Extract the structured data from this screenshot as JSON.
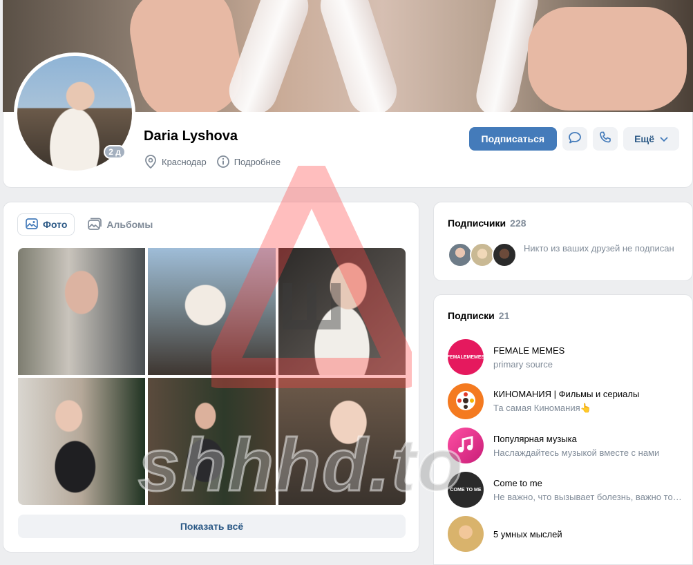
{
  "profile": {
    "name": "Daria Lyshova",
    "online_badge": "2 д",
    "city": "Краснодар",
    "details_label": "Подробнее"
  },
  "actions": {
    "subscribe_label": "Подписаться",
    "more_label": "Ещё"
  },
  "photos": {
    "tabs": [
      {
        "label": "Фото",
        "icon": "photo-icon",
        "active": true
      },
      {
        "label": "Альбомы",
        "icon": "albums-icon",
        "active": false
      }
    ],
    "show_all_label": "Показать всё"
  },
  "followers": {
    "title": "Подписчики",
    "count": "228",
    "note": "Никто из ваших друзей не подписан"
  },
  "subscriptions": {
    "title": "Подписки",
    "count": "21",
    "items": [
      {
        "name": "FEMALE MEMES",
        "desc": "primary source",
        "avatar_text": "FEMALEMEMES",
        "color": "#e5195e"
      },
      {
        "name": "КИНОМАНИЯ | Фильмы и сериалы",
        "desc": "Та самая Киномания👆",
        "avatar_text": "",
        "color": "#f47a20"
      },
      {
        "name": "Популярная музыка",
        "desc": "Наслаждайтесь музыкой вместе с нами",
        "avatar_text": "",
        "color": "#e23a8e"
      },
      {
        "name": "Come to me",
        "desc": "Не важно, что вызывает болезнь, важно то, что её лечит",
        "avatar_text": "COME TO ME",
        "color": "#2a2a2a"
      },
      {
        "name": "5 умных мыслей",
        "desc": "",
        "avatar_text": "",
        "color": "#d9b36c"
      }
    ]
  },
  "watermark": {
    "text": "shhhd.to"
  },
  "colors": {
    "accent": "#447bba",
    "link": "#2a5885",
    "muted": "#818c99"
  }
}
